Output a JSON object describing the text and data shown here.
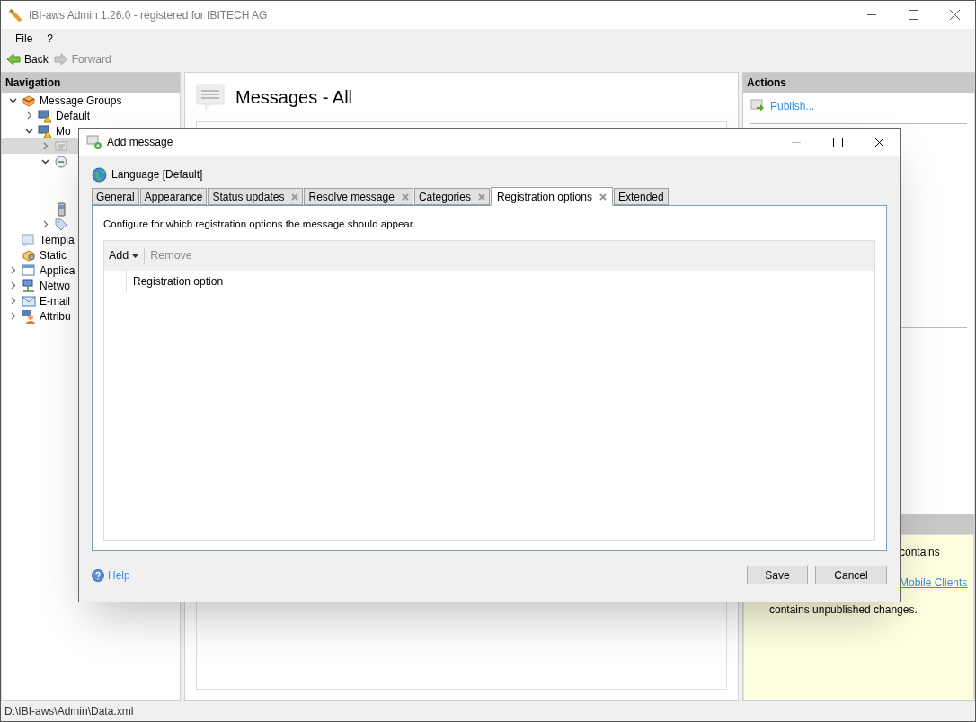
{
  "window": {
    "title": "IBI-aws Admin 1.26.0 - registered for IBITECH AG"
  },
  "menu": [
    "File",
    "?"
  ],
  "toolbar": [
    {
      "label": "Back",
      "disabled": false
    },
    {
      "label": "Forward",
      "disabled": true
    }
  ],
  "navigation": {
    "title": "Navigation",
    "tree": [
      {
        "label": "Message Groups",
        "kind": "group",
        "expanded": true,
        "selected": false,
        "children": [
          {
            "label": "Default",
            "kind": "server",
            "expanded": false,
            "selected": false
          },
          {
            "label": "Mo",
            "kind": "server",
            "expanded": true,
            "selected": false,
            "children": [
              {
                "kind": "message",
                "expanded": false,
                "selected": true
              },
              {
                "kind": "key",
                "expanded": true,
                "selected": false
              },
              {
                "kind": "phone",
                "selected": false
              },
              {
                "kind": "tag",
                "expanded": false,
                "selected": false
              }
            ]
          }
        ]
      },
      {
        "label": "Templa",
        "kind": "template",
        "selected": false
      },
      {
        "label": "Static",
        "kind": "static",
        "selected": false
      },
      {
        "label": "Applica",
        "kind": "application",
        "expanded": false,
        "selected": false
      },
      {
        "label": "Netwo",
        "kind": "network",
        "expanded": false,
        "selected": false
      },
      {
        "label": "E-mail",
        "kind": "email",
        "expanded": false,
        "selected": false
      },
      {
        "label": "Attribu",
        "kind": "attribute",
        "expanded": false,
        "selected": false
      }
    ]
  },
  "content": {
    "title": "Messages - All"
  },
  "actions": {
    "title": "Actions",
    "items": [
      "Publish..."
    ]
  },
  "info": {
    "lines": [
      {
        "kind": "text",
        "text": "contains"
      },
      {
        "kind": "link",
        "text": "Mobile Clients"
      },
      {
        "kind": "text",
        "text": "contains unpublished changes."
      }
    ]
  },
  "dialog": {
    "title": "Add message",
    "language": "Language [Default]",
    "tabs": [
      {
        "label": "General",
        "closable": false,
        "selected": false
      },
      {
        "label": "Appearance",
        "closable": false,
        "selected": false
      },
      {
        "label": "Status updates",
        "closable": true,
        "selected": false
      },
      {
        "label": "Resolve message",
        "closable": true,
        "selected": false
      },
      {
        "label": "Categories",
        "closable": true,
        "selected": false
      },
      {
        "label": "Registration options",
        "closable": true,
        "selected": true
      },
      {
        "label": "Extended",
        "closable": false,
        "selected": false
      }
    ],
    "description": "Configure for which registration options the message should appear.",
    "grid": {
      "tools": [
        {
          "label": "Add",
          "dropdown": true,
          "disabled": false
        },
        {
          "label": "Remove",
          "dropdown": false,
          "disabled": true
        }
      ],
      "columns": [
        "Registration option"
      ]
    },
    "help": "Help",
    "buttons": [
      "Save",
      "Cancel"
    ]
  },
  "status_bar": "D:\\IBI-aws\\Admin\\Data.xml"
}
